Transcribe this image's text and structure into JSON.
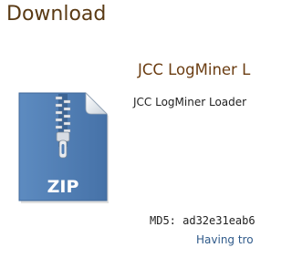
{
  "page": {
    "title": "Download"
  },
  "product": {
    "title": "JCC LogMiner L",
    "description": "JCC LogMiner Loader"
  },
  "file_icon": {
    "name": "zip-file-icon",
    "label": "ZIP"
  },
  "checksum": {
    "text": "MD5: ad32e31eab6"
  },
  "help": {
    "link_text": "Having tro"
  },
  "colors": {
    "title": "#5a3a14",
    "product_title": "#6b3d12",
    "link": "#2f5a8a",
    "icon_body": "#4f7db3"
  }
}
